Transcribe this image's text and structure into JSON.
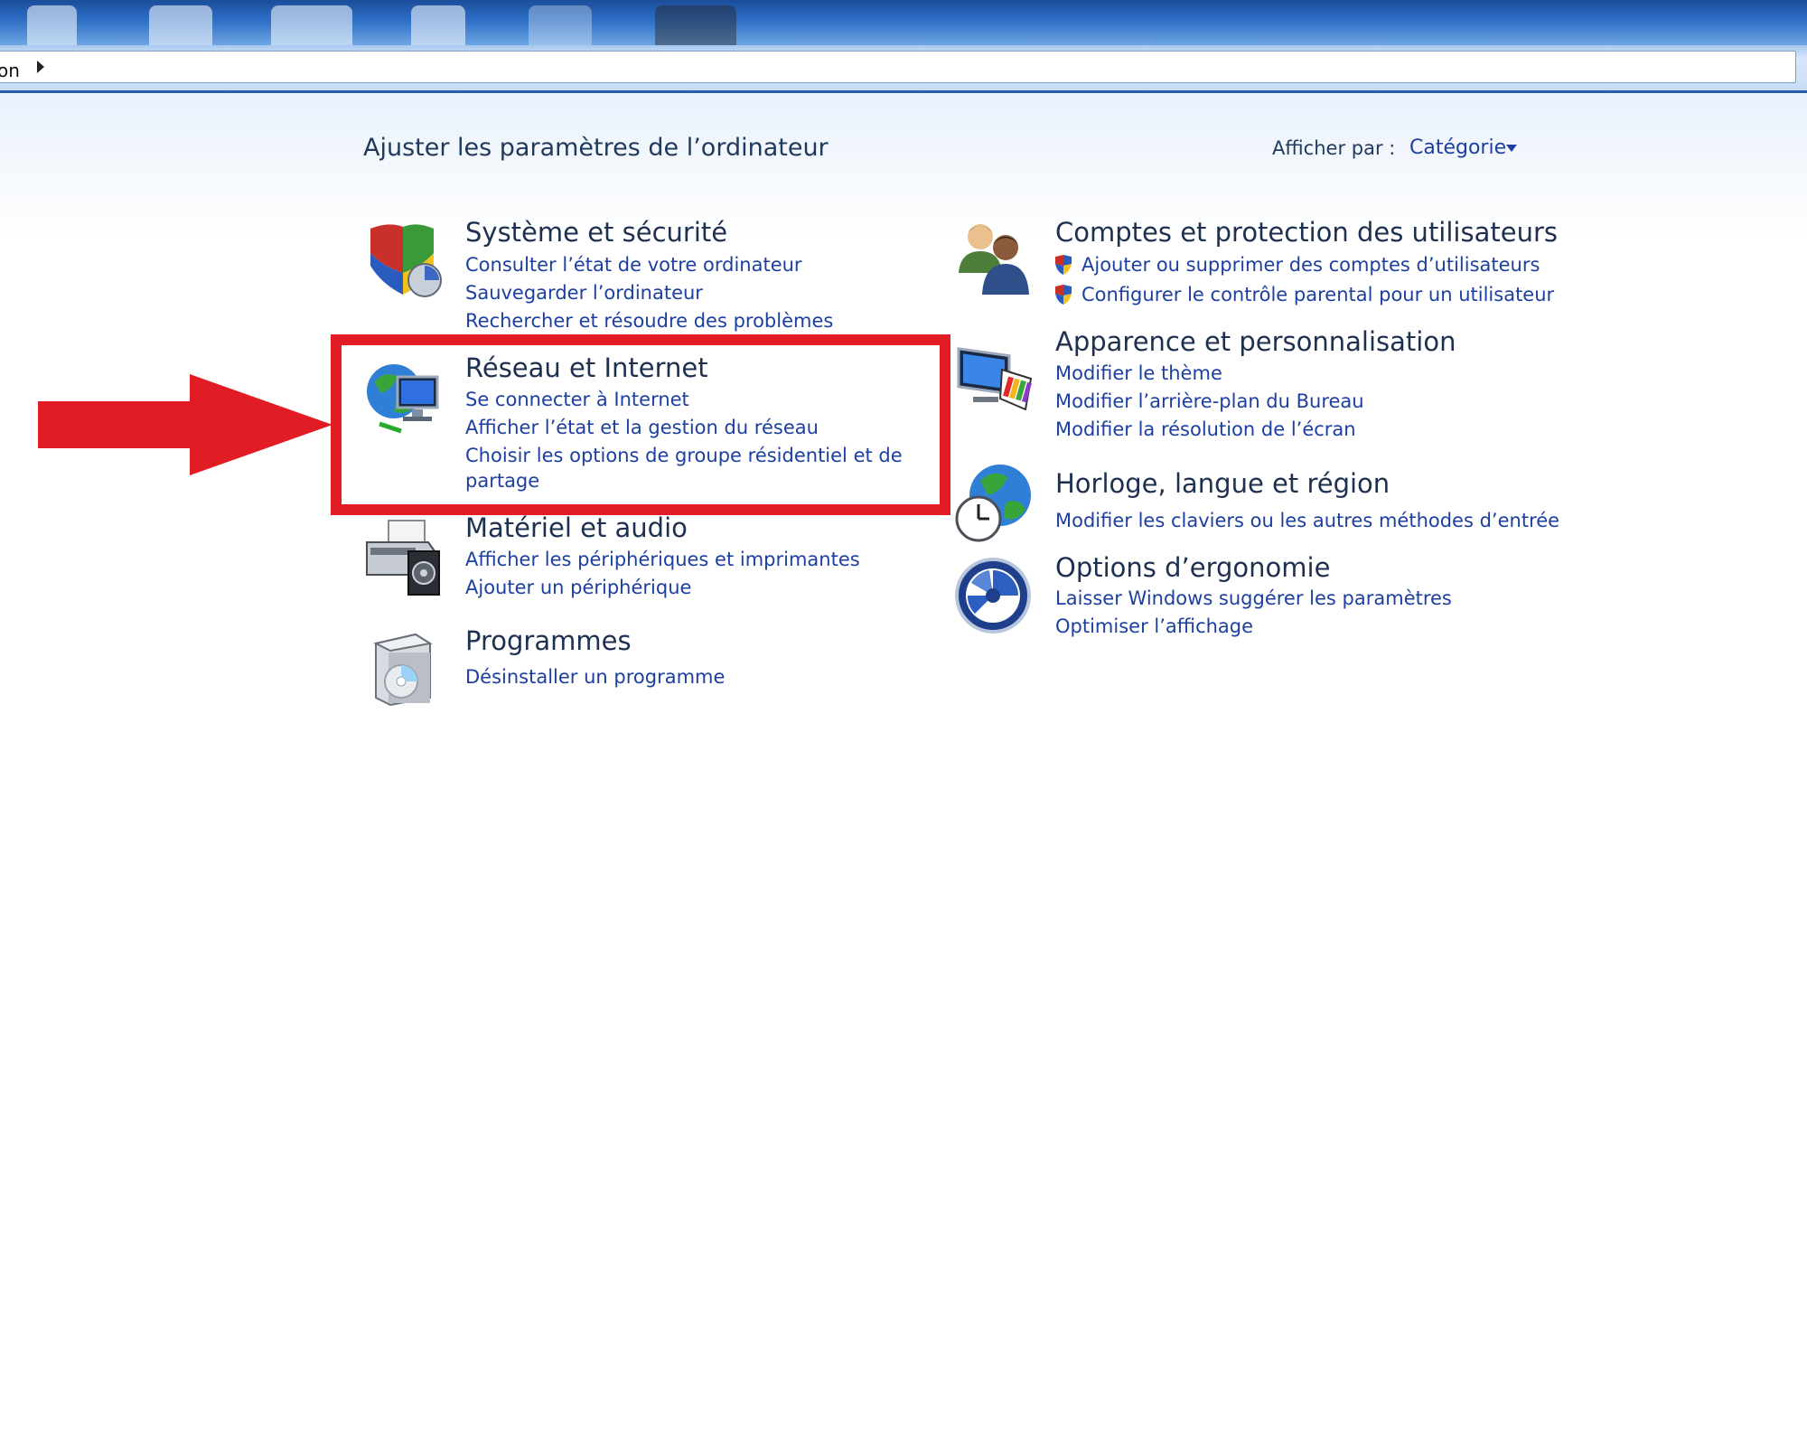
{
  "address_bar": {
    "crumb": "on"
  },
  "header": {
    "title": "Ajuster les paramètres de l’ordinateur",
    "view_by_label": "Afficher par :",
    "view_by_value": "Catégorie"
  },
  "categories": [
    {
      "title": "Système et sécurité",
      "icon": "shield-icon",
      "links": [
        "Consulter l’état de votre ordinateur",
        "Sauvegarder l’ordinateur",
        "Rechercher et résoudre des problèmes"
      ]
    },
    {
      "title": "Réseau et Internet",
      "icon": "network-globe-icon",
      "links": [
        "Se connecter à Internet",
        "Afficher l’état et la gestion du réseau",
        "Choisir les options de groupe résidentiel et de",
        "partage"
      ]
    },
    {
      "title": "Matériel et audio",
      "icon": "printer-icon",
      "links": [
        "Afficher les périphériques et imprimantes",
        "Ajouter un périphérique"
      ]
    },
    {
      "title": "Programmes",
      "icon": "programs-icon",
      "links": [
        "Désinstaller un programme"
      ]
    },
    {
      "title": "Comptes et protection des utilisateurs",
      "icon": "users-icon",
      "links": [
        "Ajouter ou supprimer des comptes d’utilisateurs",
        "Configurer le contrôle parental pour un utilisateur"
      ]
    },
    {
      "title": "Apparence et personnalisation",
      "icon": "monitor-palette-icon",
      "links": [
        "Modifier le thème",
        "Modifier l’arrière-plan du Bureau",
        "Modifier la résolution de l’écran"
      ]
    },
    {
      "title": "Horloge, langue et région",
      "icon": "clock-globe-icon",
      "links": [
        "Modifier les claviers ou les autres méthodes d’entrée"
      ]
    },
    {
      "title": "Options d’ergonomie",
      "icon": "ease-of-access-icon",
      "links": [
        "Laisser Windows suggérer les paramètres",
        "Optimiser l’affichage"
      ]
    }
  ],
  "colors": {
    "link": "#1c3fa0",
    "title": "#1e3050",
    "highlight": "#e11c24"
  }
}
